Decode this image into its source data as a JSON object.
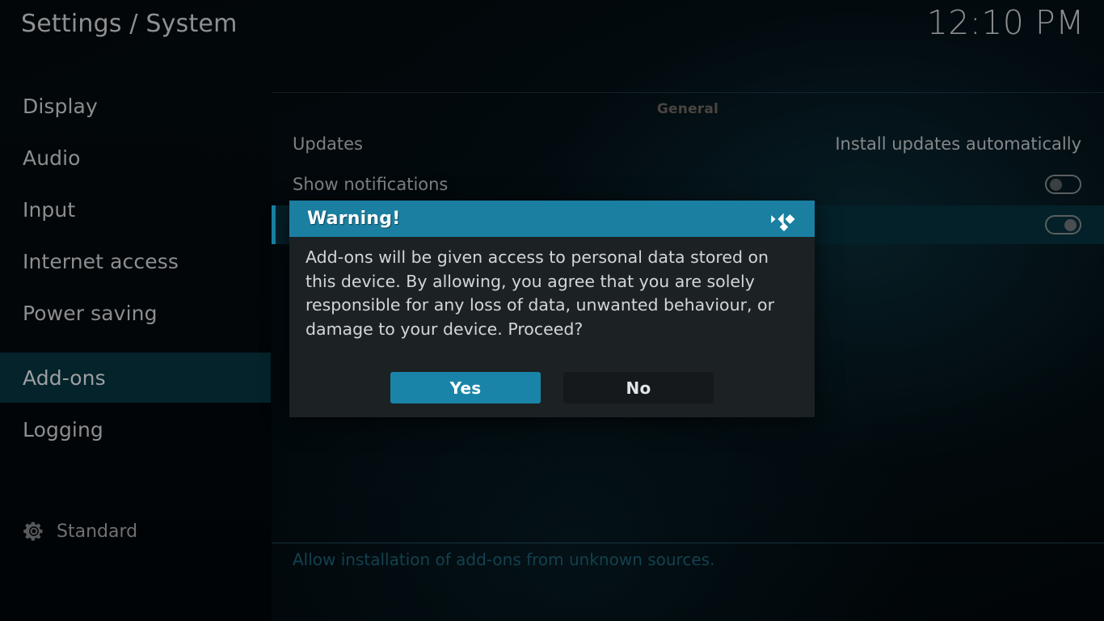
{
  "header": {
    "title": "Settings / System",
    "clock": "12:10 PM"
  },
  "sidebar": {
    "items": [
      {
        "label": "Display",
        "selected": false
      },
      {
        "label": "Audio",
        "selected": false
      },
      {
        "label": "Input",
        "selected": false
      },
      {
        "label": "Internet access",
        "selected": false
      },
      {
        "label": "Power saving",
        "selected": false
      },
      {
        "label": "Add-ons",
        "selected": true
      },
      {
        "label": "Logging",
        "selected": false
      }
    ],
    "profile": {
      "icon": "gear-icon",
      "label": "Standard"
    }
  },
  "main": {
    "group_title": "General",
    "rows": [
      {
        "label": "Updates",
        "value": "Install updates automatically",
        "control": "text",
        "state": "",
        "highlight": false
      },
      {
        "label": "Show notifications",
        "value": "",
        "control": "toggle",
        "state": "off",
        "highlight": false
      },
      {
        "label": "",
        "value": "",
        "control": "toggle",
        "state": "on",
        "highlight": true
      }
    ]
  },
  "help": {
    "text": "Allow installation of add-ons from unknown sources."
  },
  "dialog": {
    "title": "Warning!",
    "logo_icon": "kodi-logo-icon",
    "message": "Add-ons will be given access to personal data stored on this device. By allowing, you agree that you are solely responsible for any loss of data, unwanted behaviour, or damage to your device. Proceed?",
    "buttons": [
      {
        "label": "Yes",
        "focused": true
      },
      {
        "label": "No",
        "focused": false
      }
    ]
  },
  "colors": {
    "accent": "#1a84a8",
    "dialog_header": "#1a7fa0",
    "dialog_bg": "#1c2124",
    "row_highlight": "#042029",
    "sidebar_highlight": "#04232b",
    "help_text": "#13414f"
  }
}
